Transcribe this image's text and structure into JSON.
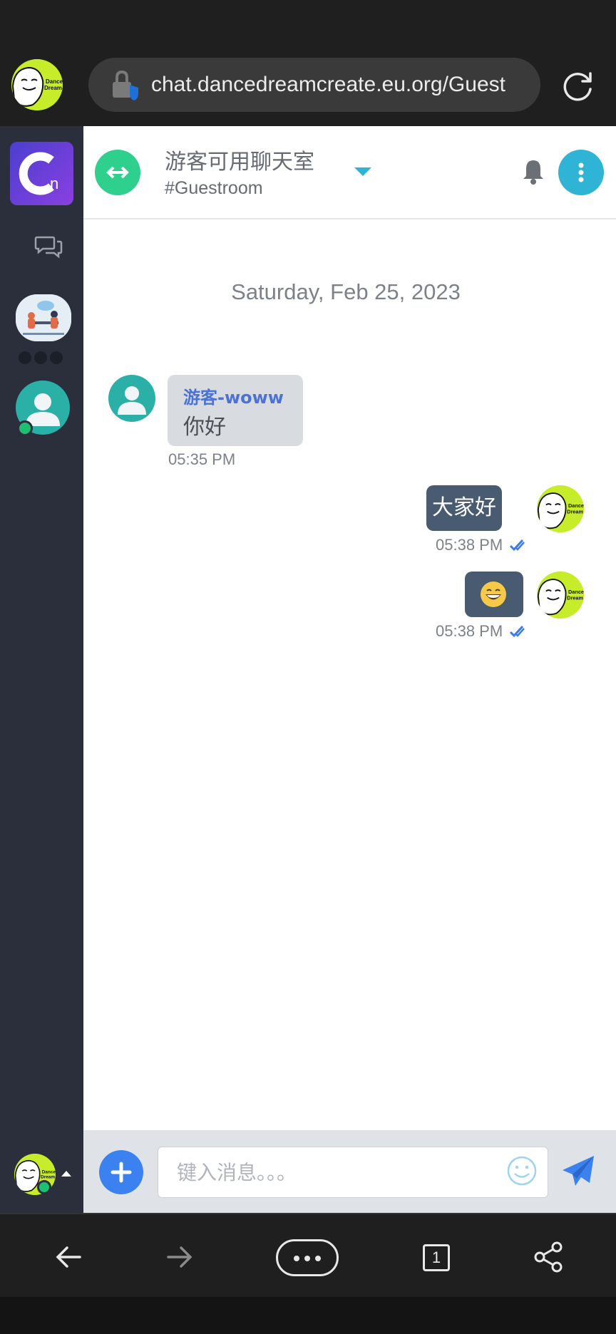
{
  "browser": {
    "url": "chat.dancedreamcreate.eu.org/Guest",
    "tab_count": "1"
  },
  "brand_avatar_text": [
    "Dance",
    "Dream"
  ],
  "header": {
    "room_title": "游客可用聊天室",
    "room_subtitle": "#Guestroom"
  },
  "chat": {
    "date_divider": "Saturday, Feb 25, 2023",
    "messages": [
      {
        "sender": "游客-woww",
        "text": "你好",
        "time": "05:35 PM",
        "direction": "incoming"
      },
      {
        "text": "大家好",
        "time": "05:38 PM",
        "direction": "outgoing"
      },
      {
        "emoji": "grinning-face-emoji",
        "time": "05:38 PM",
        "direction": "outgoing"
      }
    ]
  },
  "composer": {
    "placeholder": "键入消息。。。"
  },
  "colors": {
    "sidebar": "#2a2f3b",
    "accent_green": "#2fcf8d",
    "accent_cyan": "#2fb4d6",
    "outgoing_bubble": "#485b71",
    "incoming_bubble": "#d8dce1",
    "sender_name": "#4a72d8",
    "send_blue": "#3b82f0"
  }
}
